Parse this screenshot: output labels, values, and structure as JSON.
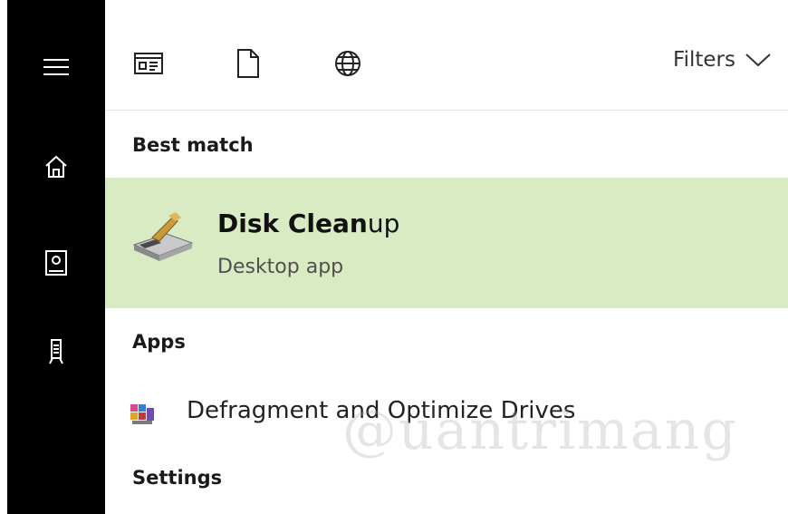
{
  "rail": {
    "items": [
      {
        "name": "hamburger-menu-icon"
      },
      {
        "name": "home-icon"
      },
      {
        "name": "notebook-icon"
      },
      {
        "name": "device-icon"
      }
    ]
  },
  "topbar": {
    "tabs": [
      {
        "name": "apps-tab-icon"
      },
      {
        "name": "documents-tab-icon"
      },
      {
        "name": "web-tab-icon"
      }
    ],
    "filters_label": "Filters"
  },
  "sections": {
    "best_match": "Best match",
    "apps": "Apps",
    "settings": "Settings"
  },
  "best_match": {
    "title_bold": "Disk Clean",
    "title_rest": "up",
    "subtitle": "Desktop app",
    "icon": "disk-cleanup-icon"
  },
  "apps": [
    {
      "label": "Defragment and Optimize Drives",
      "icon": "defragment-icon"
    }
  ],
  "watermark": "@uantrimang",
  "colors": {
    "rail_bg": "#000000",
    "highlight_bg": "#d9ebc3",
    "text": "#1a1a1a",
    "subtext": "#505050"
  }
}
